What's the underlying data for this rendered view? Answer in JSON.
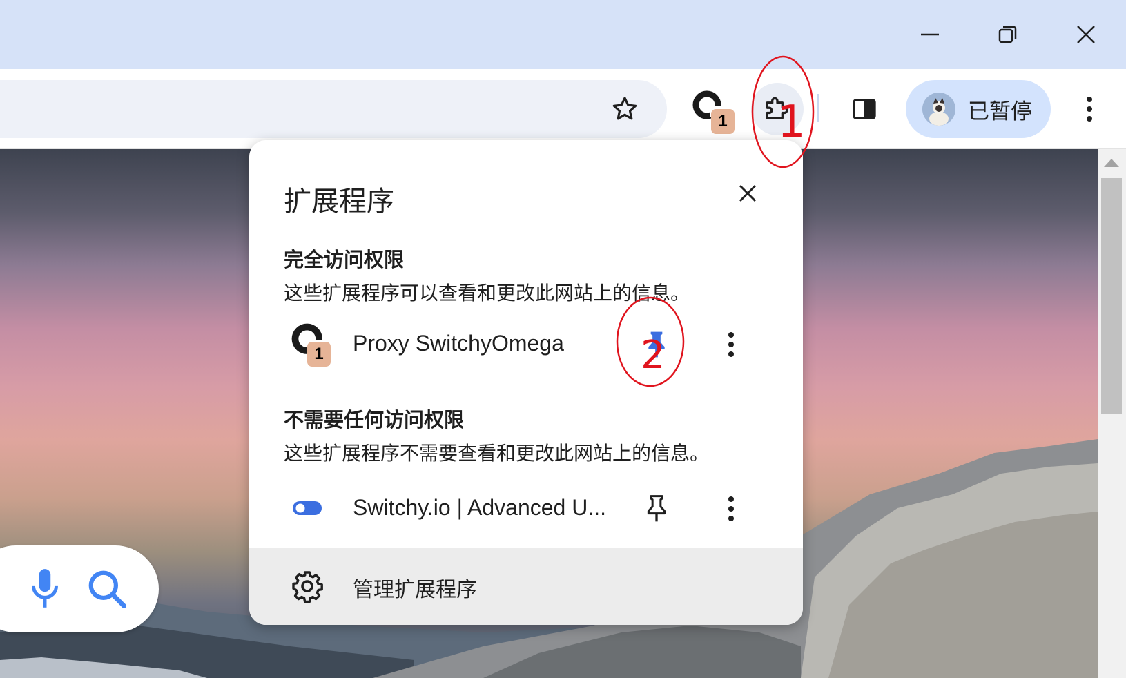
{
  "window": {
    "controls": [
      "minimize",
      "restore",
      "close"
    ]
  },
  "toolbar": {
    "extension_badge": "1",
    "profile_label": "已暂停"
  },
  "extensions_popup": {
    "title": "扩展程序",
    "full_access": {
      "heading": "完全访问权限",
      "description": "这些扩展程序可以查看和更改此网站上的信息。",
      "items": [
        {
          "name": "Proxy SwitchyOmega",
          "badge": "1",
          "pinned": true
        }
      ]
    },
    "no_access": {
      "heading": "不需要任何访问权限",
      "description": "这些扩展程序不需要查看和更改此网站上的信息。",
      "items": [
        {
          "name": "Switchy.io | Advanced U...",
          "pinned": false
        }
      ]
    },
    "manage_label": "管理扩展程序"
  },
  "annotations": {
    "label_1": "1",
    "label_2": "2",
    "color": "#e0141e"
  },
  "colors": {
    "titlebar": "#d6e2f8",
    "profile_chip": "#d3e3fd",
    "pin_active": "#3b6ee0",
    "toggle_blue": "#3b6ee0"
  }
}
